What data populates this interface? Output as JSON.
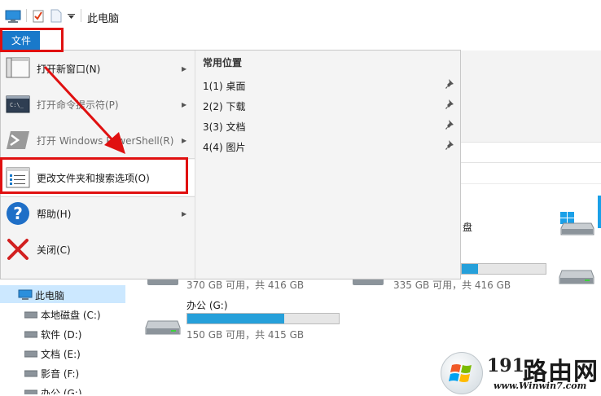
{
  "title_bar": {
    "title": "此电脑"
  },
  "ribbon": {
    "file_tab": "文件"
  },
  "file_menu": {
    "items": [
      {
        "label": "打开新窗口(N)",
        "icon": "new-window-icon",
        "state": "normal",
        "submenu": true
      },
      {
        "label": "打开命令提示符(P)",
        "icon": "command-prompt-icon",
        "state": "disabled",
        "submenu": true
      },
      {
        "label": "打开 Windows PowerShell(R)",
        "icon": "powershell-icon",
        "state": "disabled",
        "submenu": true
      },
      {
        "label": "更改文件夹和搜索选项(O)",
        "icon": "folder-options-icon",
        "state": "highlighted",
        "submenu": false
      },
      {
        "label": "帮助(H)",
        "icon": "help-icon",
        "state": "normal",
        "submenu": true
      },
      {
        "label": "关闭(C)",
        "icon": "close-icon",
        "state": "normal",
        "submenu": false
      }
    ],
    "recent_title": "常用位置",
    "recent_items": [
      {
        "label": "1(1)  桌面",
        "pinned": true
      },
      {
        "label": "2(2)  下载",
        "pinned": true
      },
      {
        "label": "3(3)  文档",
        "pinned": true
      },
      {
        "label": "4(4)  图片",
        "pinned": true
      }
    ]
  },
  "drives": [
    {
      "name": "",
      "size_text": "370 GB 可用，共 416 GB",
      "used_fraction": 0.11
    },
    {
      "name": "盘",
      "size_text": "335 GB 可用，共 416 GB",
      "used_fraction": 0.19
    },
    {
      "name": "办公 (G:)",
      "size_text": "150 GB 可用，共 415 GB",
      "used_fraction": 0.64
    }
  ],
  "nav_tree": {
    "items": [
      {
        "label": "此电脑",
        "icon": "this-pc-icon",
        "selected": true
      },
      {
        "label": "本地磁盘 (C:)",
        "icon": "drive-icon"
      },
      {
        "label": "软件 (D:)",
        "icon": "drive-icon"
      },
      {
        "label": "文档 (E:)",
        "icon": "drive-icon"
      },
      {
        "label": "影音 (F:)",
        "icon": "drive-icon"
      },
      {
        "label": "办公 (G:)",
        "icon": "drive-icon"
      }
    ]
  },
  "watermark": {
    "number": "191",
    "brand": "路由网",
    "url": "www.Winwin7.com"
  },
  "colors": {
    "accent": "#1979ca",
    "highlight_box": "#e01010",
    "drive_fill": "#26a0da",
    "nav_selected": "#cce8ff"
  }
}
